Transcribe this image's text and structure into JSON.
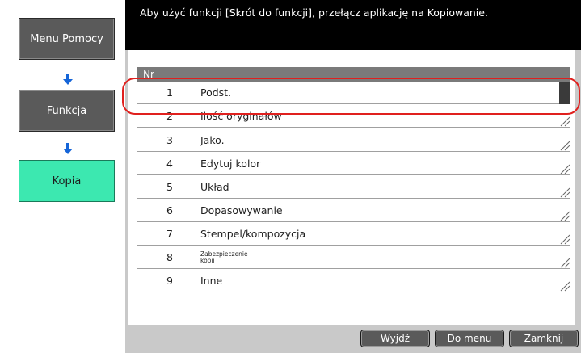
{
  "sidebar": {
    "items": [
      {
        "label": "Menu Pomocy"
      },
      {
        "label": "Funkcja"
      },
      {
        "label": "Kopia"
      }
    ],
    "arrow_glyph": "🡇"
  },
  "message": "Aby użyć funkcji [Skrót do funkcji], przełącz aplikację na Kopiowanie.",
  "list": {
    "header": "Nr",
    "rows": [
      {
        "num": "1",
        "label": "Podst."
      },
      {
        "num": "2",
        "label": "Ilość oryginałów"
      },
      {
        "num": "3",
        "label": "Jako."
      },
      {
        "num": "4",
        "label": "Edytuj kolor"
      },
      {
        "num": "5",
        "label": "Układ"
      },
      {
        "num": "6",
        "label": "Dopasowywanie"
      },
      {
        "num": "7",
        "label": "Stempel/kompozycja"
      },
      {
        "num": "8",
        "label": "Zabezpieczenie kopii"
      },
      {
        "num": "9",
        "label": "Inne"
      }
    ]
  },
  "footer": {
    "exit_label": "Wyjdź",
    "menu_label": "Do menu",
    "close_label": "Zamknij"
  },
  "colors": {
    "current_item": "#3ce8b0",
    "highlight": "#e0201e",
    "arrow": "#1565d8"
  }
}
